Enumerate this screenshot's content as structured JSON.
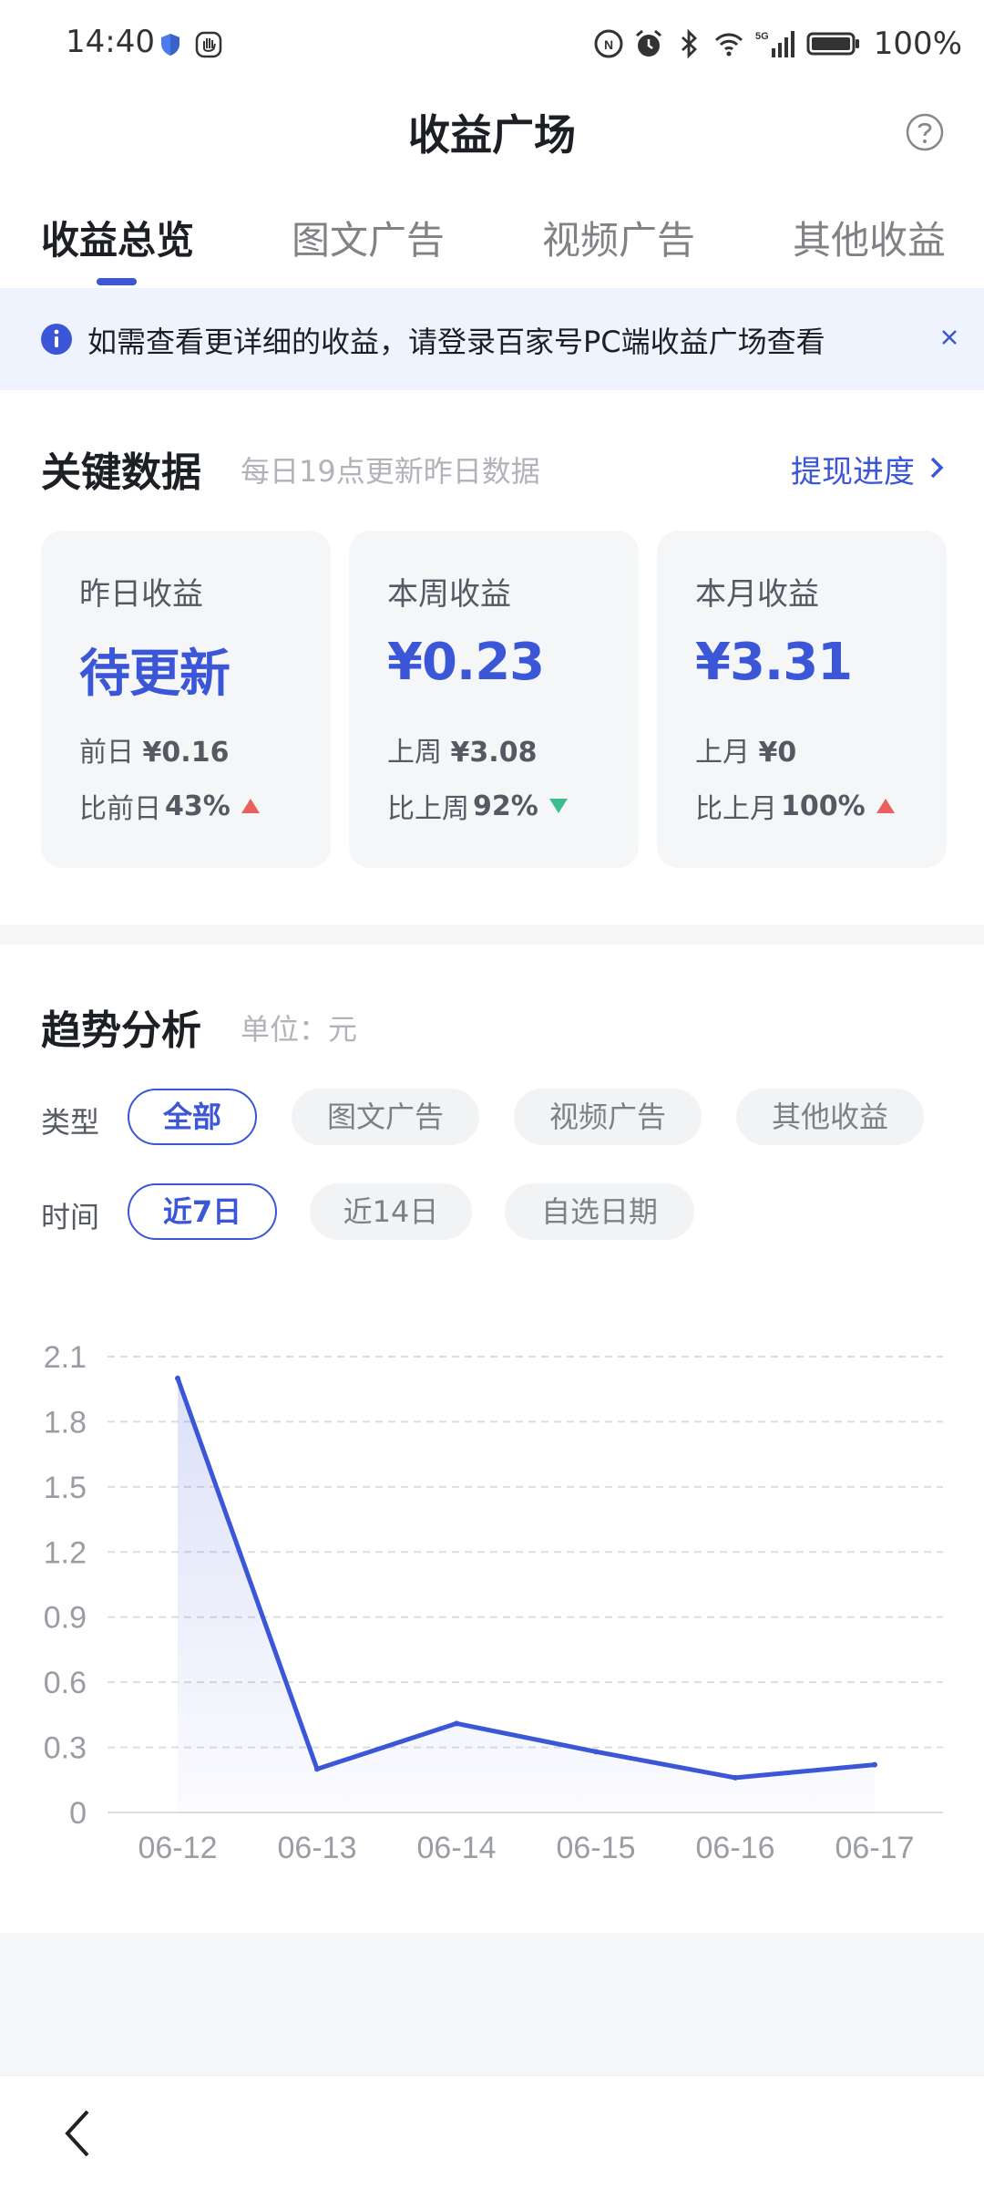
{
  "status_bar": {
    "time": "14:40",
    "battery": "100%",
    "icons": [
      "shield-icon",
      "hand-icon",
      "nfc-icon",
      "alarm-icon",
      "bluetooth-icon",
      "wifi-icon",
      "signal-5g-icon",
      "battery-icon"
    ]
  },
  "header": {
    "title": "收益广场",
    "help_icon": "help-icon"
  },
  "tabs": [
    {
      "label": "收益总览",
      "active": true
    },
    {
      "label": "图文广告",
      "active": false
    },
    {
      "label": "视频广告",
      "active": false
    },
    {
      "label": "其他收益",
      "active": false
    }
  ],
  "notice": {
    "text": "如需查看更详细的收益，请登录百家号PC端收益广场查看",
    "icon": "info-icon",
    "close_icon": "close-icon"
  },
  "key_data": {
    "title": "关键数据",
    "subtitle": "每日19点更新昨日数据",
    "link": "提现进度",
    "cards": [
      {
        "label": "昨日收益",
        "value": "待更新",
        "prev_label": "前日",
        "prev_value": "¥0.16",
        "ratio_label": "比前日",
        "ratio_value": "43%",
        "trend": "up"
      },
      {
        "label": "本周收益",
        "value": "¥0.23",
        "prev_label": "上周",
        "prev_value": "¥3.08",
        "ratio_label": "比上周",
        "ratio_value": "92%",
        "trend": "down"
      },
      {
        "label": "本月收益",
        "value": "¥3.31",
        "prev_label": "上月",
        "prev_value": "¥0",
        "ratio_label": "比上月",
        "ratio_value": "100%",
        "trend": "up"
      }
    ]
  },
  "trend": {
    "title": "趋势分析",
    "unit": "单位：元",
    "type_label": "类型",
    "type_options": [
      {
        "label": "全部",
        "active": true
      },
      {
        "label": "图文广告",
        "active": false
      },
      {
        "label": "视频广告",
        "active": false
      },
      {
        "label": "其他收益",
        "active": false
      }
    ],
    "time_label": "时间",
    "time_options": [
      {
        "label": "近7日",
        "active": true
      },
      {
        "label": "近14日",
        "active": false
      },
      {
        "label": "自选日期",
        "active": false
      }
    ]
  },
  "colors": {
    "accent": "#3b56d6",
    "up": "#e8615f",
    "down": "#3dbd8f"
  },
  "chart_data": {
    "type": "area",
    "categories": [
      "06-12",
      "06-13",
      "06-14",
      "06-15",
      "06-16",
      "06-17"
    ],
    "series": [
      {
        "values": [
          2.0,
          0.2,
          0.41,
          0.28,
          0.16,
          0.22
        ]
      }
    ],
    "yticks": [
      "2.1",
      "1.8",
      "1.5",
      "1.2",
      "0.9",
      "0.6",
      "0.3",
      "0"
    ],
    "ylim": [
      0,
      2.1
    ],
    "grid": true
  },
  "nav": {
    "back_icon": "back-icon"
  }
}
